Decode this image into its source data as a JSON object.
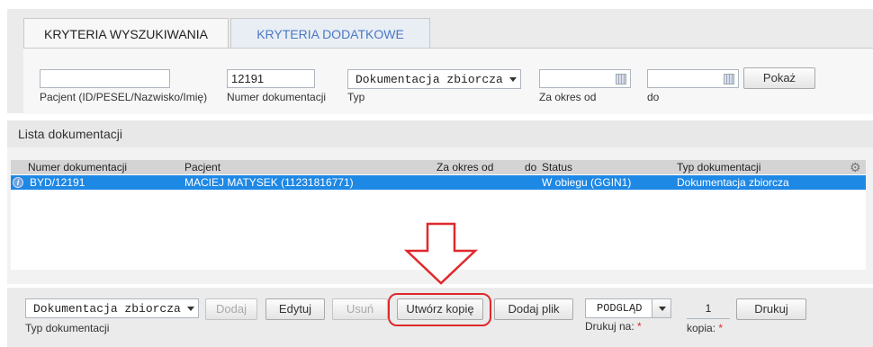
{
  "tabs": {
    "search_criteria": "KRYTERIA WYSZUKIWANIA",
    "additional_criteria": "KRYTERIA DODATKOWE"
  },
  "filters": {
    "patient": {
      "value": "",
      "label": "Pacjent (ID/PESEL/Nazwisko/Imię)"
    },
    "doc_number": {
      "value": "12191",
      "label": "Numer dokumentacji"
    },
    "type": {
      "value": "Dokumentacja zbiorcza",
      "label": "Typ"
    },
    "date_from": {
      "value": "",
      "label": "Za okres od"
    },
    "date_to": {
      "value": "",
      "label": "do"
    },
    "show_button": "Pokaż"
  },
  "list": {
    "title": "Lista dokumentacji",
    "columns": [
      "Numer dokumentacji",
      "Pacjent",
      "Za okres od",
      "do",
      "Status",
      "Typ dokumentacji"
    ],
    "rows": [
      {
        "number": "BYD/12191",
        "patient": "MACIEJ MATYSEK (11231816771)",
        "from": "",
        "to": "",
        "status": "W obiegu (GGIN1)",
        "type": "Dokumentacja zbiorcza"
      }
    ]
  },
  "actions": {
    "doc_type": {
      "value": "Dokumentacja zbiorcza",
      "label": "Typ dokumentacji"
    },
    "add": "Dodaj",
    "edit": "Edytuj",
    "delete": "Usuń",
    "create_copy": "Utwórz kopię",
    "add_file": "Dodaj plik",
    "print_mode": {
      "value": "PODGLĄD",
      "label": "Drukuj na:"
    },
    "copies": {
      "value": "1",
      "label": "kopia:"
    },
    "print": "Drukuj",
    "required_mark": "*"
  },
  "colors": {
    "accent": "#1e88e5",
    "tab_inactive_text": "#4a78c2",
    "annotation_red": "#e0282c"
  },
  "icons": [
    "calendar-icon",
    "dropdown-arrow-icon",
    "info-icon",
    "gear-icon",
    "down-arrow-annotation"
  ]
}
